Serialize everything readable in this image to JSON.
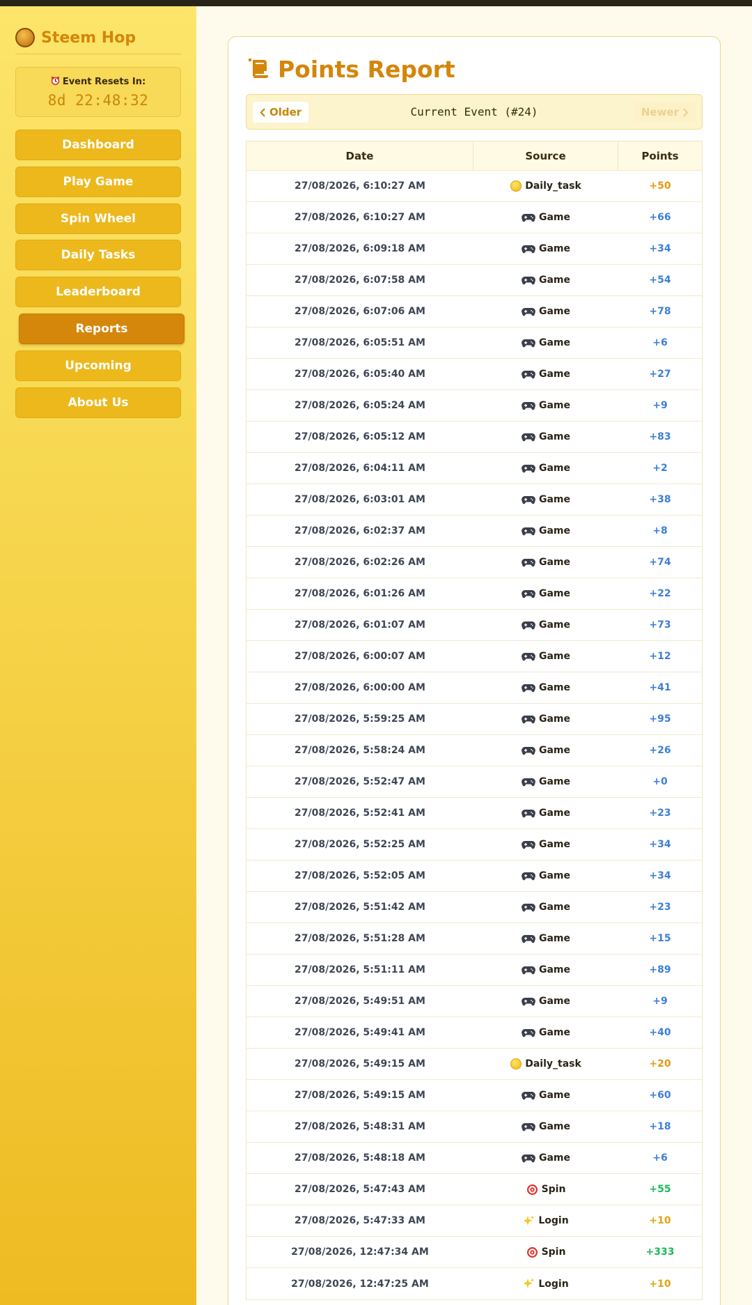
{
  "sidebar": {
    "brand": "Steem Hop",
    "brand_logo_text": "STEEM HOP",
    "timer_label": "Event Resets In:",
    "timer_value": "8d 22:48:32",
    "nav": [
      {
        "label": "Dashboard",
        "active": false
      },
      {
        "label": "Play Game",
        "active": false
      },
      {
        "label": "Spin Wheel",
        "active": false
      },
      {
        "label": "Daily Tasks",
        "active": false
      },
      {
        "label": "Leaderboard",
        "active": false
      },
      {
        "label": "Reports",
        "active": true
      },
      {
        "label": "Upcoming",
        "active": false
      },
      {
        "label": "About Us",
        "active": false
      }
    ]
  },
  "main": {
    "title": "Points Report",
    "pager": {
      "older": "Older",
      "current": "Current Event (#24)",
      "newer": "Newer"
    },
    "columns": [
      "Date",
      "Source",
      "Points"
    ],
    "colors": {
      "daily_task": "#e09a10",
      "game": "#3d7fd6",
      "spin": "#1cb85a",
      "login": "#e0a410"
    },
    "rows": [
      {
        "date": "27/08/2026, 6:10:27 AM",
        "source": "Daily_task",
        "icon": "coin-icon",
        "points": "+50"
      },
      {
        "date": "27/08/2026, 6:10:27 AM",
        "source": "Game",
        "icon": "gamepad-icon",
        "points": "+66"
      },
      {
        "date": "27/08/2026, 6:09:18 AM",
        "source": "Game",
        "icon": "gamepad-icon",
        "points": "+34"
      },
      {
        "date": "27/08/2026, 6:07:58 AM",
        "source": "Game",
        "icon": "gamepad-icon",
        "points": "+54"
      },
      {
        "date": "27/08/2026, 6:07:06 AM",
        "source": "Game",
        "icon": "gamepad-icon",
        "points": "+78"
      },
      {
        "date": "27/08/2026, 6:05:51 AM",
        "source": "Game",
        "icon": "gamepad-icon",
        "points": "+6"
      },
      {
        "date": "27/08/2026, 6:05:40 AM",
        "source": "Game",
        "icon": "gamepad-icon",
        "points": "+27"
      },
      {
        "date": "27/08/2026, 6:05:24 AM",
        "source": "Game",
        "icon": "gamepad-icon",
        "points": "+9"
      },
      {
        "date": "27/08/2026, 6:05:12 AM",
        "source": "Game",
        "icon": "gamepad-icon",
        "points": "+83"
      },
      {
        "date": "27/08/2026, 6:04:11 AM",
        "source": "Game",
        "icon": "gamepad-icon",
        "points": "+2"
      },
      {
        "date": "27/08/2026, 6:03:01 AM",
        "source": "Game",
        "icon": "gamepad-icon",
        "points": "+38"
      },
      {
        "date": "27/08/2026, 6:02:37 AM",
        "source": "Game",
        "icon": "gamepad-icon",
        "points": "+8"
      },
      {
        "date": "27/08/2026, 6:02:26 AM",
        "source": "Game",
        "icon": "gamepad-icon",
        "points": "+74"
      },
      {
        "date": "27/08/2026, 6:01:26 AM",
        "source": "Game",
        "icon": "gamepad-icon",
        "points": "+22"
      },
      {
        "date": "27/08/2026, 6:01:07 AM",
        "source": "Game",
        "icon": "gamepad-icon",
        "points": "+73"
      },
      {
        "date": "27/08/2026, 6:00:07 AM",
        "source": "Game",
        "icon": "gamepad-icon",
        "points": "+12"
      },
      {
        "date": "27/08/2026, 6:00:00 AM",
        "source": "Game",
        "icon": "gamepad-icon",
        "points": "+41"
      },
      {
        "date": "27/08/2026, 5:59:25 AM",
        "source": "Game",
        "icon": "gamepad-icon",
        "points": "+95"
      },
      {
        "date": "27/08/2026, 5:58:24 AM",
        "source": "Game",
        "icon": "gamepad-icon",
        "points": "+26"
      },
      {
        "date": "27/08/2026, 5:52:47 AM",
        "source": "Game",
        "icon": "gamepad-icon",
        "points": "+0"
      },
      {
        "date": "27/08/2026, 5:52:41 AM",
        "source": "Game",
        "icon": "gamepad-icon",
        "points": "+23"
      },
      {
        "date": "27/08/2026, 5:52:25 AM",
        "source": "Game",
        "icon": "gamepad-icon",
        "points": "+34"
      },
      {
        "date": "27/08/2026, 5:52:05 AM",
        "source": "Game",
        "icon": "gamepad-icon",
        "points": "+34"
      },
      {
        "date": "27/08/2026, 5:51:42 AM",
        "source": "Game",
        "icon": "gamepad-icon",
        "points": "+23"
      },
      {
        "date": "27/08/2026, 5:51:28 AM",
        "source": "Game",
        "icon": "gamepad-icon",
        "points": "+15"
      },
      {
        "date": "27/08/2026, 5:51:11 AM",
        "source": "Game",
        "icon": "gamepad-icon",
        "points": "+89"
      },
      {
        "date": "27/08/2026, 5:49:51 AM",
        "source": "Game",
        "icon": "gamepad-icon",
        "points": "+9"
      },
      {
        "date": "27/08/2026, 5:49:41 AM",
        "source": "Game",
        "icon": "gamepad-icon",
        "points": "+40"
      },
      {
        "date": "27/08/2026, 5:49:15 AM",
        "source": "Daily_task",
        "icon": "coin-icon",
        "points": "+20"
      },
      {
        "date": "27/08/2026, 5:49:15 AM",
        "source": "Game",
        "icon": "gamepad-icon",
        "points": "+60"
      },
      {
        "date": "27/08/2026, 5:48:31 AM",
        "source": "Game",
        "icon": "gamepad-icon",
        "points": "+18"
      },
      {
        "date": "27/08/2026, 5:48:18 AM",
        "source": "Game",
        "icon": "gamepad-icon",
        "points": "+6"
      },
      {
        "date": "27/08/2026, 5:47:43 AM",
        "source": "Spin",
        "icon": "target-icon",
        "points": "+55"
      },
      {
        "date": "27/08/2026, 5:47:33 AM",
        "source": "Login",
        "icon": "sparkles-icon",
        "points": "+10"
      },
      {
        "date": "27/08/2026, 12:47:34 AM",
        "source": "Spin",
        "icon": "target-icon",
        "points": "+333"
      },
      {
        "date": "27/08/2026, 12:47:25 AM",
        "source": "Login",
        "icon": "sparkles-icon",
        "points": "+10"
      }
    ]
  }
}
